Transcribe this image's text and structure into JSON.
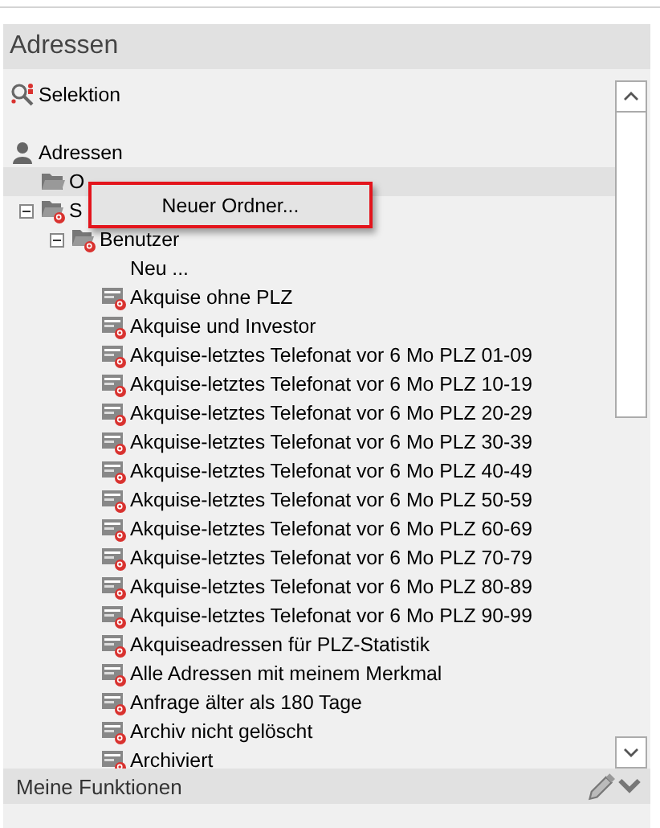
{
  "panel": {
    "title": "Adressen"
  },
  "selection": {
    "label": "Selektion"
  },
  "tree": [
    {
      "label": "Adressen",
      "kind": "person",
      "selected": false,
      "children": [
        {
          "label": "O",
          "kind": "folder",
          "selected": true
        },
        {
          "label": "S",
          "kind": "search_folder",
          "selected": false,
          "expanded": true,
          "children": [
            {
              "label": "Benutzer",
              "kind": "search_folder",
              "selected": false,
              "expanded": true,
              "children": [
                {
                  "label": "Neu ...",
                  "kind": "new",
                  "selected": false
                },
                {
                  "label": "Akquise ohne PLZ",
                  "kind": "query",
                  "selected": false
                },
                {
                  "label": "Akquise und Investor",
                  "kind": "query",
                  "selected": false
                },
                {
                  "label": "Akquise-letztes Telefonat vor 6 Mo PLZ 01-09",
                  "kind": "query",
                  "selected": false
                },
                {
                  "label": "Akquise-letztes Telefonat vor 6 Mo PLZ 10-19",
                  "kind": "query",
                  "selected": false
                },
                {
                  "label": "Akquise-letztes Telefonat vor 6 Mo PLZ 20-29",
                  "kind": "query",
                  "selected": false
                },
                {
                  "label": "Akquise-letztes Telefonat vor 6 Mo PLZ 30-39",
                  "kind": "query",
                  "selected": false
                },
                {
                  "label": "Akquise-letztes Telefonat vor 6 Mo PLZ 40-49",
                  "kind": "query",
                  "selected": false
                },
                {
                  "label": "Akquise-letztes Telefonat vor 6 Mo PLZ 50-59",
                  "kind": "query",
                  "selected": false
                },
                {
                  "label": "Akquise-letztes Telefonat vor 6 Mo PLZ 60-69",
                  "kind": "query",
                  "selected": false
                },
                {
                  "label": "Akquise-letztes Telefonat vor 6 Mo PLZ 70-79",
                  "kind": "query",
                  "selected": false
                },
                {
                  "label": "Akquise-letztes Telefonat vor 6 Mo PLZ 80-89",
                  "kind": "query",
                  "selected": false
                },
                {
                  "label": "Akquise-letztes Telefonat vor 6 Mo PLZ 90-99",
                  "kind": "query",
                  "selected": false
                },
                {
                  "label": "Akquiseadressen für PLZ-Statistik",
                  "kind": "query",
                  "selected": false
                },
                {
                  "label": "Alle Adressen mit meinem Merkmal",
                  "kind": "query",
                  "selected": false
                },
                {
                  "label": "Anfrage älter als 180 Tage",
                  "kind": "query",
                  "selected": false
                },
                {
                  "label": "Archiv nicht gelöscht",
                  "kind": "query",
                  "selected": false
                },
                {
                  "label": "Archiviert",
                  "kind": "query",
                  "selected": false
                }
              ]
            }
          ]
        }
      ]
    }
  ],
  "context_menu": {
    "items": [
      {
        "label": "Neuer Ordner..."
      }
    ]
  },
  "footer": {
    "title": "Meine Funktionen"
  }
}
